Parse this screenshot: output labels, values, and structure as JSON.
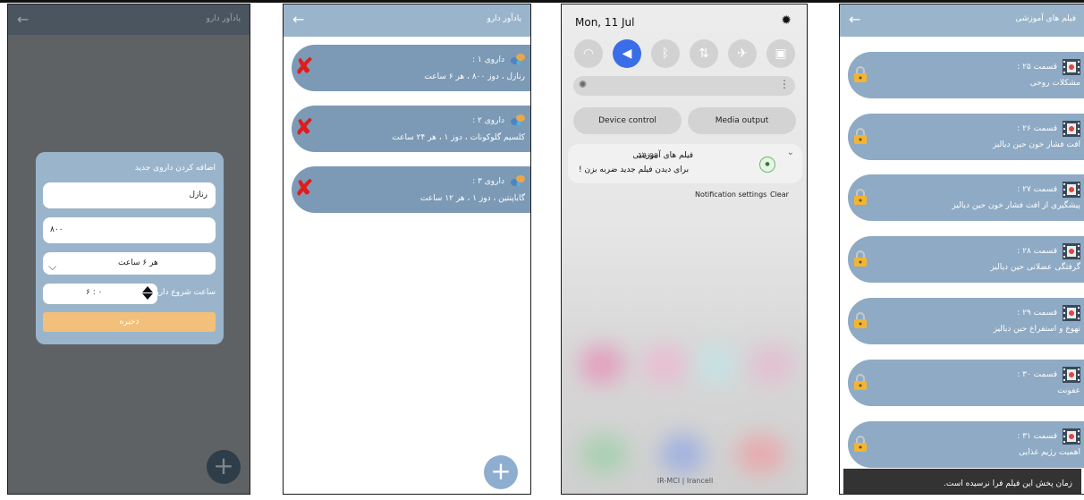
{
  "screen1": {
    "title": "یادآور دارو",
    "dialog_title": "اضافه کردن داروی جدید",
    "name_value": "رنازل",
    "dose_value": "۸۰۰",
    "interval_value": "هر ۶ ساعت",
    "start_label": "ساعت شروع دارو",
    "start_value": "۶ : ۰",
    "save_label": "ذخیره"
  },
  "screen2": {
    "title": "یادآور دارو",
    "drugs": [
      {
        "line1": "داروی ۱ :",
        "line2": "رنازل ، دوز ۸۰۰ ، هر ۶ ساعت"
      },
      {
        "line1": "داروی ۲ :",
        "line2": "کلسیم گلوکونات ، دوز ۱ ، هر ۲۴ ساعت"
      },
      {
        "line1": "داروی ۳ :",
        "line2": "گاباپنتین ، دوز ۱ ، هر ۱۲ ساعت"
      }
    ]
  },
  "screen3": {
    "date": "Mon, 11 Jul",
    "device_control": "Device control",
    "media_output": "Media output",
    "notif_title": "فیلم های آموزشی",
    "notif_time": "16:00",
    "notif_body": "برای دیدن فیلم جدید ضربه بزن !",
    "notif_settings": "Notification settings",
    "clear": "Clear",
    "carrier": "IR-MCI | Irancell"
  },
  "screen4": {
    "title": "فیلم های آموزشی",
    "episodes": [
      {
        "line1": "قسمت ۲۵ :",
        "line2": "مشکلات روحی"
      },
      {
        "line1": "قسمت ۲۶ :",
        "line2": "افت فشار خون حین دیالیز"
      },
      {
        "line1": "قسمت ۲۷ :",
        "line2": "پیشگیری از افت فشار خون حین دیالیز"
      },
      {
        "line1": "قسمت ۲۸ :",
        "line2": "گرفتگی عضلانی حین دیالیز"
      },
      {
        "line1": "قسمت ۲۹ :",
        "line2": "تهوع و استفراغ حین دیالیز"
      },
      {
        "line1": "قسمت ۳۰ :",
        "line2": "عفونت"
      },
      {
        "line1": "قسمت ۳۱ :",
        "line2": "اهمیت رژیم غذایی"
      }
    ],
    "toast": "زمان پخش این فیلم فرا نرسیده است."
  }
}
